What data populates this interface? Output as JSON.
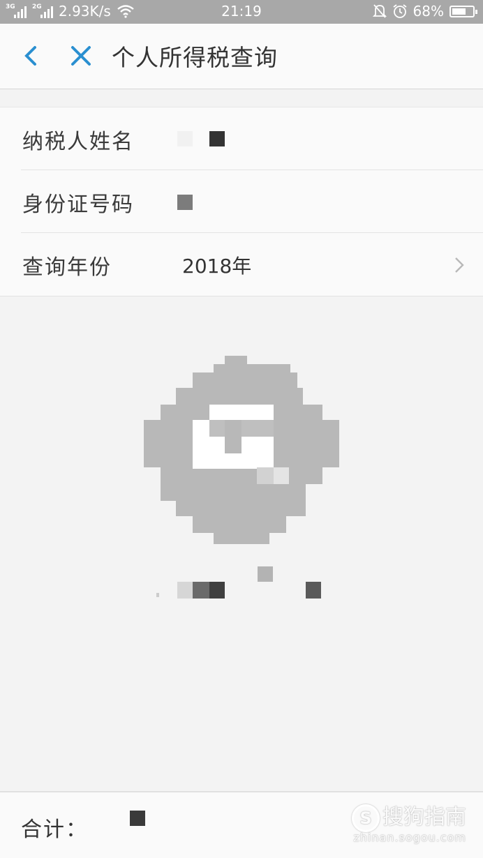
{
  "status_bar": {
    "network_1": "3G",
    "network_2": "2G",
    "speed": "2.93K/s",
    "time": "21:19",
    "battery": "68%",
    "battery_level": 0.68,
    "icons": [
      "wifi-icon",
      "bell-off-icon",
      "alarm-icon",
      "battery-icon"
    ]
  },
  "header": {
    "title": "个人所得税查询",
    "back_icon": "chevron-left-icon",
    "close_icon": "close-icon",
    "accent_color": "#2a8fd0"
  },
  "form": {
    "rows": [
      {
        "label": "纳税人姓名",
        "value": ""
      },
      {
        "label": "身份证号码",
        "value": ""
      },
      {
        "label": "查询年份",
        "value": "2018年"
      }
    ]
  },
  "empty_state": {
    "emblem_color": "#b8b8b8"
  },
  "footer": {
    "total_label": "合计：",
    "watermark_brand": "搜狗指南",
    "watermark_domain": "zhinan.sogou.com"
  }
}
